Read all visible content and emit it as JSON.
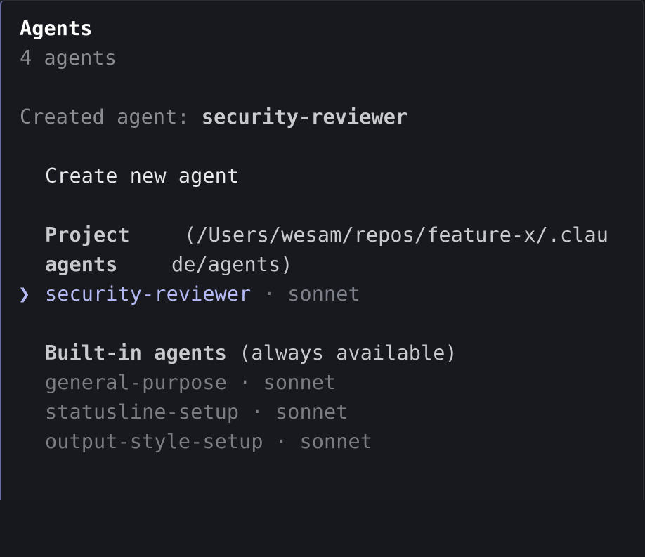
{
  "header": {
    "title": "Agents",
    "count": "4 agents"
  },
  "status": {
    "prefix": "Created agent: ",
    "agent_name": "security-reviewer"
  },
  "create_action": {
    "label": "Create new agent"
  },
  "project_section": {
    "label_line1": "Project",
    "label_line2": "agents",
    "path_line1": "(/Users/wesam/repos/feature-x/.clau",
    "path_line2": "de/agents)",
    "items": [
      {
        "name": "security-reviewer",
        "separator": " · ",
        "model": "sonnet",
        "selected": true
      }
    ],
    "pointer": "❯"
  },
  "builtin_section": {
    "label": "Built-in agents",
    "note": " (always available)",
    "items": [
      {
        "name": "general-purpose",
        "separator": " · ",
        "model": "sonnet"
      },
      {
        "name": "statusline-setup",
        "separator": " · ",
        "model": "sonnet"
      },
      {
        "name": "output-style-setup",
        "separator": " · ",
        "model": "sonnet"
      }
    ]
  },
  "colors": {
    "background": "#17191e",
    "accent": "#b4b8f2",
    "border_accent": "#6b6f9e"
  }
}
